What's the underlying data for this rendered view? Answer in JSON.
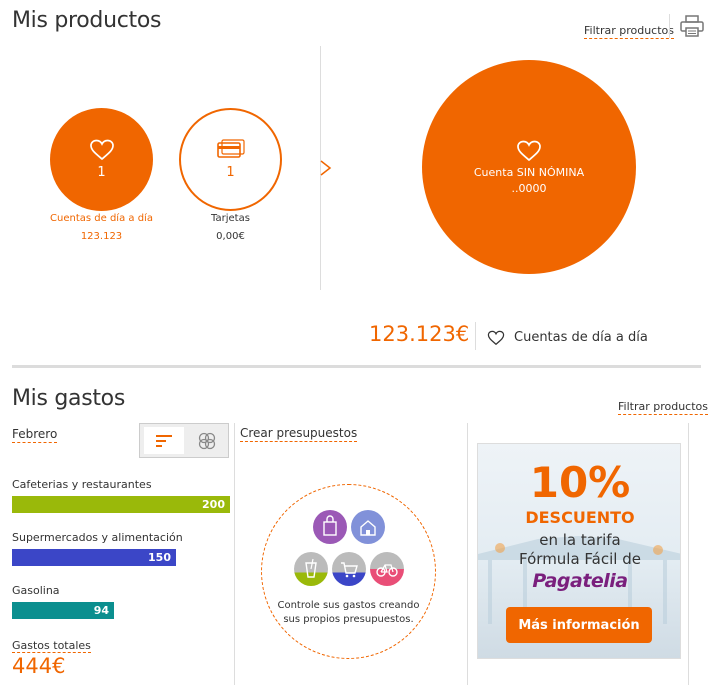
{
  "products": {
    "title": "Mis productos",
    "filter_label": "Filtrar productos",
    "print_icon": "printer-icon",
    "summary_items": [
      {
        "icon": "heart-icon",
        "count": "1",
        "label": "Cuentas de día a día",
        "value": "123.123"
      },
      {
        "icon": "card-icon",
        "count": "1",
        "label": "Tarjetas",
        "value": "0,00€"
      }
    ],
    "next_icon": "chevron-right-icon",
    "selected": {
      "icon": "heart-icon",
      "name": "Cuenta SIN NÓMINA",
      "number": "..0000"
    },
    "total": {
      "amount": "123.123€",
      "label": "Cuentas de día a día"
    }
  },
  "expenses": {
    "title": "Mis gastos",
    "filter_label": "Filtrar productos",
    "month": "Febrero",
    "view_toggle": [
      "bars-icon",
      "donut-icon"
    ],
    "chart_data": {
      "type": "bar",
      "orientation": "horizontal",
      "categories": [
        "Cafeterias y restaurantes",
        "Supermercados y alimentación",
        "Gasolina"
      ],
      "values": [
        200,
        150,
        94
      ],
      "colors": [
        "#9ab90a",
        "#3b46c7",
        "#0b8f8f"
      ]
    },
    "total_label": "Gastos totales",
    "total_value": "444€",
    "budget": {
      "title": "Crear presupuestos",
      "text_line1": "Controle sus gastos creando",
      "text_line2": "sus propios presupuestos.",
      "category_icons": [
        "shopping-bag-icon",
        "house-icon",
        "drink-icon",
        "cart-icon",
        "bicycle-icon"
      ]
    },
    "ad": {
      "percent": "10%",
      "discount": "DESCUENTO",
      "line1": "en la tarifa",
      "line2": "Fórmula Fácil de",
      "brand": "Pagatelia",
      "cta": "Más información"
    }
  },
  "colors": {
    "accent": "#f06600",
    "divider": "#dcdcdc"
  }
}
